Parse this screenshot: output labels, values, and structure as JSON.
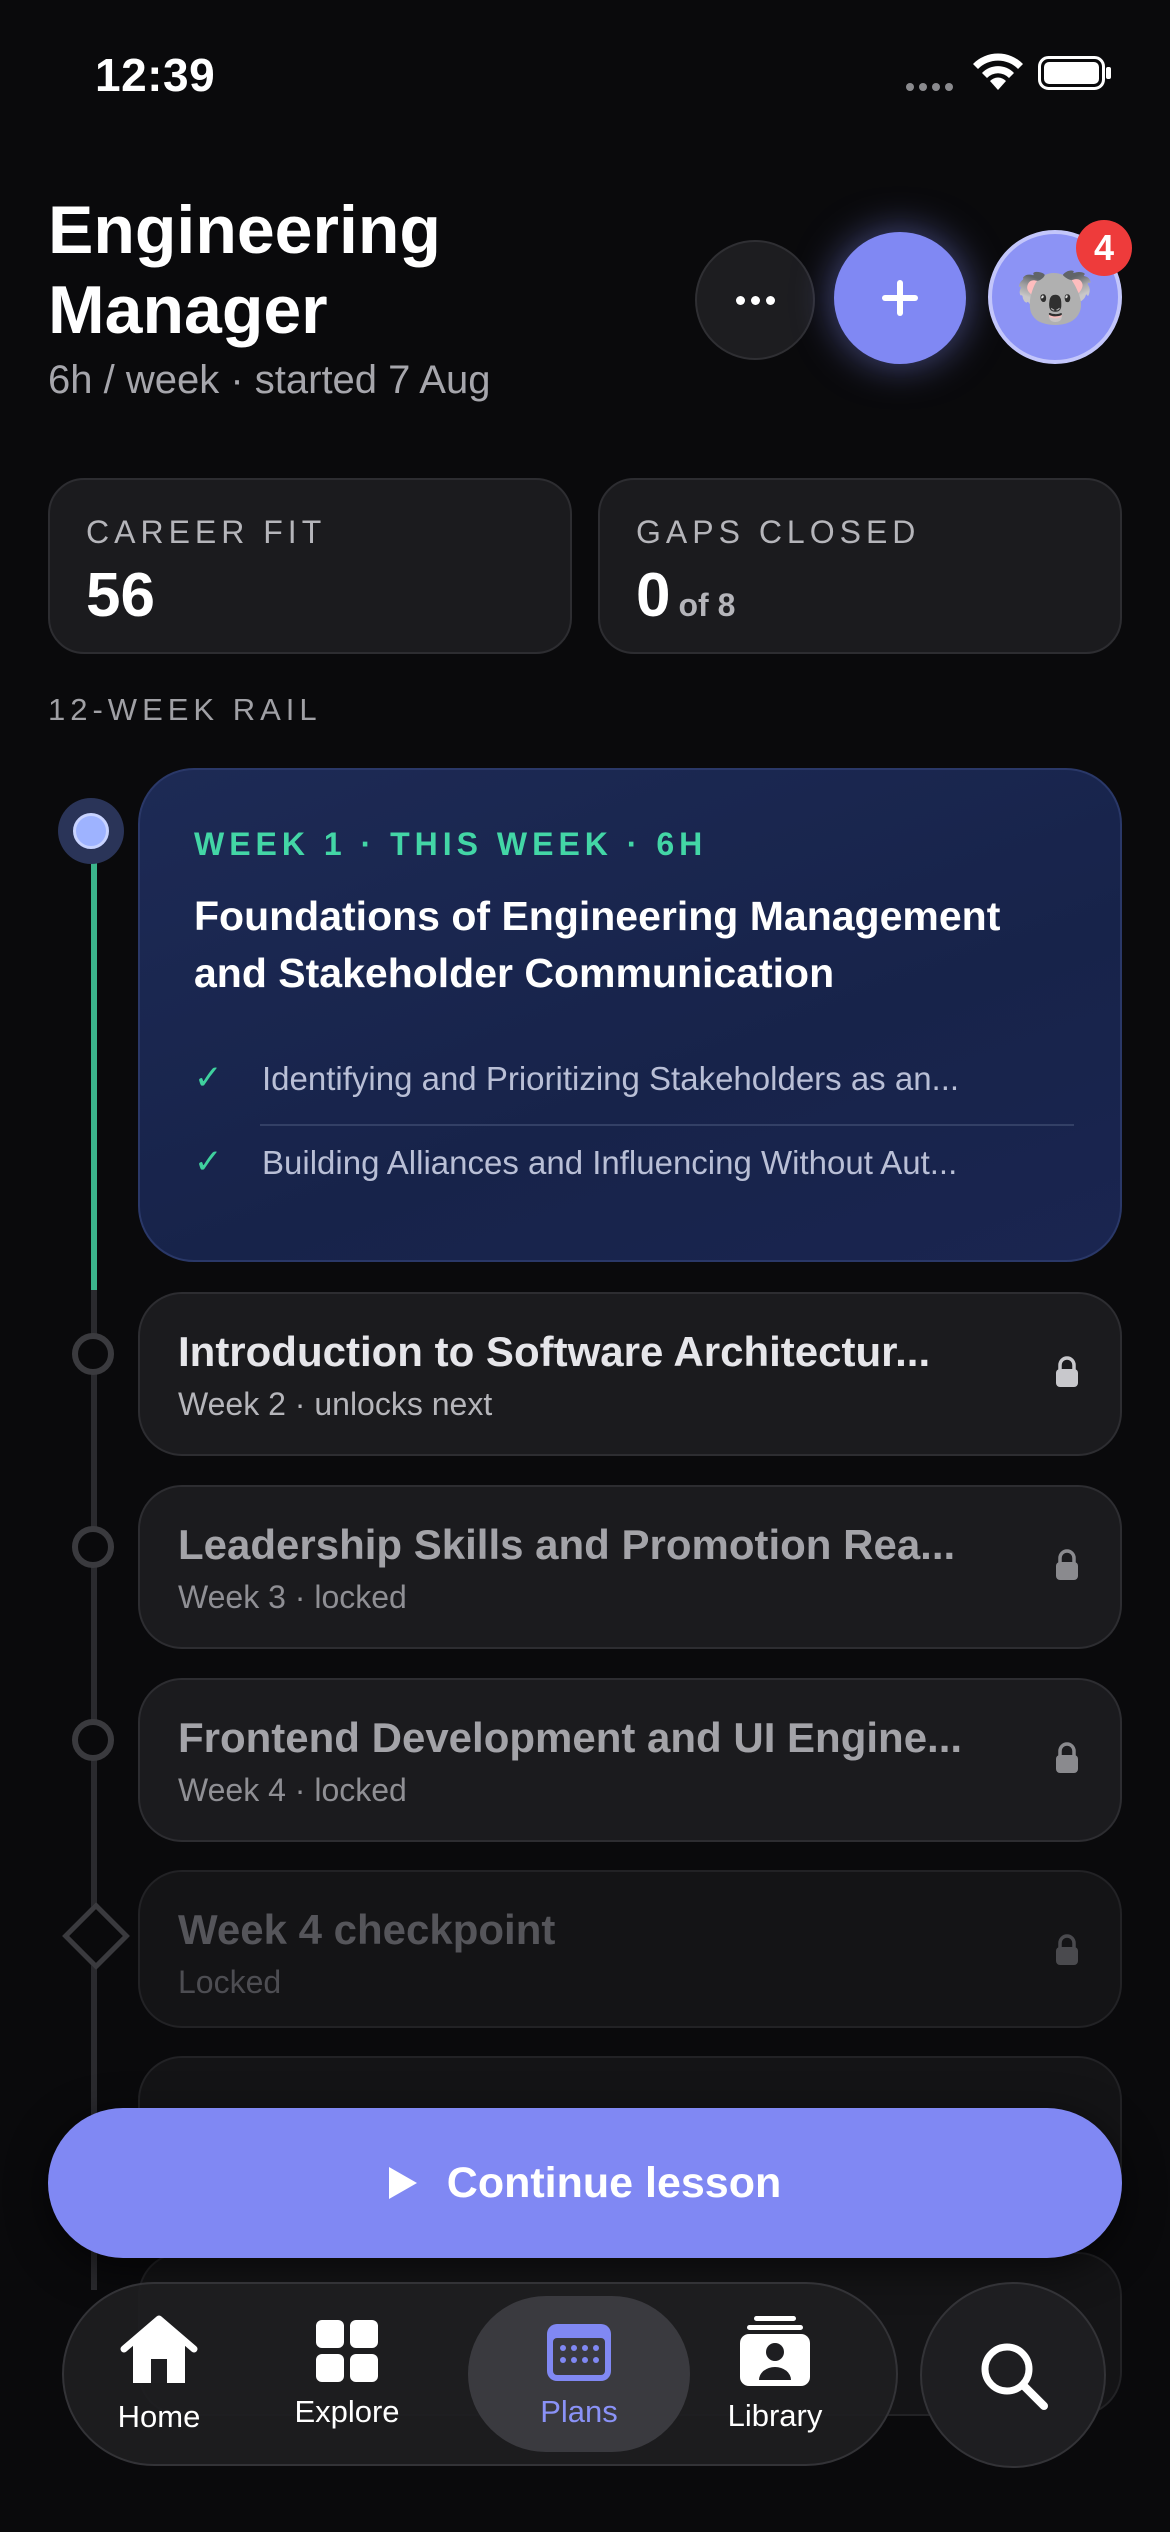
{
  "status_bar": {
    "time": "12:39"
  },
  "header": {
    "title": "Engineering Manager",
    "subtitle": "6h / week · started 7 Aug",
    "notification_count": "4",
    "avatar_emoji": "🐨"
  },
  "stats": {
    "career_fit": {
      "label": "CAREER FIT",
      "value": "56"
    },
    "gaps_closed": {
      "label": "GAPS CLOSED",
      "value": "0",
      "of": "of 8"
    }
  },
  "rail": {
    "label": "12-WEEK RAIL",
    "current": {
      "kicker": "WEEK 1 · THIS WEEK · 6H",
      "title": "Foundations of Engineering Management and Stakeholder Communication",
      "items": [
        {
          "text": "Identifying and Prioritizing Stakeholders as an...",
          "done": true
        },
        {
          "text": "Building Alliances and Influencing Without Aut...",
          "done": true
        }
      ]
    },
    "weeks": [
      {
        "title": "Introduction to Software Architectur...",
        "sub": "Week 2 · unlocks next",
        "state": "next"
      },
      {
        "title": "Leadership Skills and Promotion Rea...",
        "sub": "Week 3 · locked",
        "state": "locked"
      },
      {
        "title": "Frontend Development and UI Engine...",
        "sub": "Week 4 · locked",
        "state": "locked"
      },
      {
        "title": "Week 4 checkpoint",
        "sub": "Locked",
        "state": "checkpoint"
      }
    ]
  },
  "cta": {
    "label": "Continue lesson"
  },
  "tabbar": {
    "tabs": [
      {
        "label": "Home",
        "icon": "home-icon"
      },
      {
        "label": "Explore",
        "icon": "grid-icon"
      },
      {
        "label": "Plans",
        "icon": "calendar-icon",
        "active": true
      },
      {
        "label": "Library",
        "icon": "library-icon"
      }
    ],
    "search_icon": "search-icon"
  },
  "colors": {
    "accent": "#8088f3",
    "success": "#3fd19e",
    "badge": "#ee3b3b"
  }
}
